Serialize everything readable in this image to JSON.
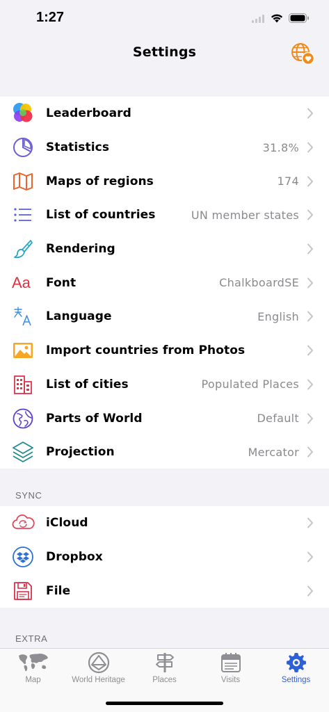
{
  "status_bar": {
    "time": "1:27"
  },
  "nav": {
    "title": "Settings",
    "action_icon": "globe-heart-icon"
  },
  "main_group": [
    {
      "label": "Leaderboard",
      "value": "",
      "icon": "leaderboard-icon"
    },
    {
      "label": "Statistics",
      "value": "31.8%",
      "icon": "pie-chart-icon"
    },
    {
      "label": "Maps of regions",
      "value": "174",
      "icon": "map-icon"
    },
    {
      "label": "List of countries",
      "value": "UN member states",
      "icon": "list-icon"
    },
    {
      "label": "Rendering",
      "value": "",
      "icon": "paintbrush-icon"
    },
    {
      "label": "Font",
      "value": "ChalkboardSE",
      "icon": "font-icon"
    },
    {
      "label": "Language",
      "value": "English",
      "icon": "language-icon"
    },
    {
      "label": "Import countries from Photos",
      "value": "",
      "icon": "photo-icon"
    },
    {
      "label": "List of cities",
      "value": "Populated Places",
      "icon": "buildings-icon"
    },
    {
      "label": "Parts of World",
      "value": "Default",
      "icon": "globe-icon"
    },
    {
      "label": "Projection",
      "value": "Mercator",
      "icon": "layers-icon"
    }
  ],
  "sync": {
    "header": "SYNC",
    "items": [
      {
        "label": "iCloud",
        "icon": "icloud-sync-icon"
      },
      {
        "label": "Dropbox",
        "icon": "dropbox-icon"
      },
      {
        "label": "File",
        "icon": "floppy-disk-icon"
      }
    ]
  },
  "extra": {
    "header": "EXTRA"
  },
  "tabs": [
    {
      "label": "Map",
      "icon": "world-map-icon",
      "active": false
    },
    {
      "label": "World Heritage",
      "icon": "world-heritage-icon",
      "active": false
    },
    {
      "label": "Places",
      "icon": "signpost-icon",
      "active": false
    },
    {
      "label": "Visits",
      "icon": "calendar-icon",
      "active": false
    },
    {
      "label": "Settings",
      "icon": "gear-icon",
      "active": true
    }
  ],
  "colors": {
    "accent": "#2d5fd6",
    "orange": "#f08a1c",
    "grouped_background": "#f2f2f7",
    "secondary_text": "#8a8a8e"
  }
}
